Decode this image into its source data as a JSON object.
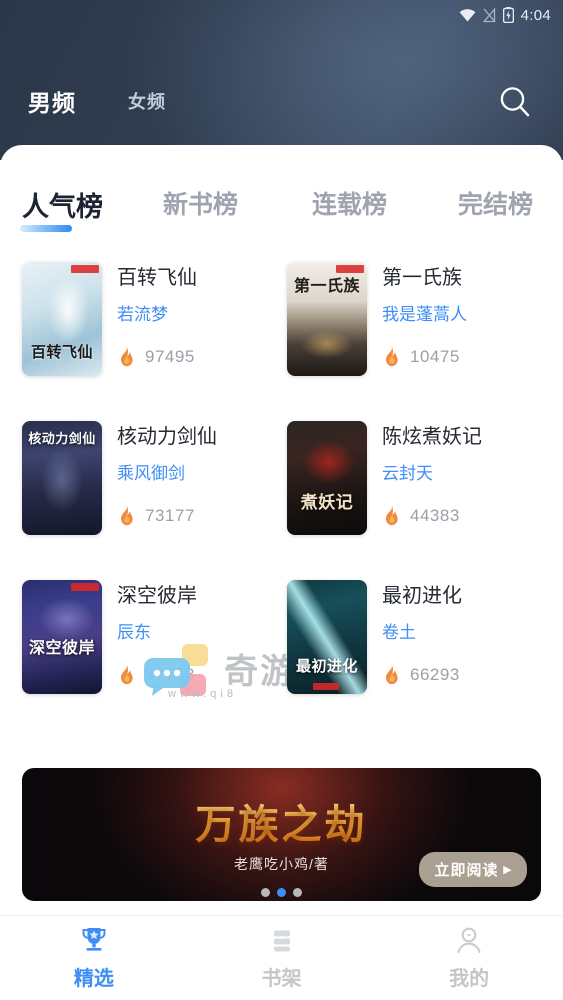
{
  "statusbar": {
    "time": "4:04",
    "icons": [
      "wifi-icon",
      "signal-off-icon",
      "battery-charging-icon"
    ]
  },
  "header": {
    "channels": [
      {
        "label": "男频",
        "active": true
      },
      {
        "label": "女频",
        "active": false
      }
    ],
    "search_icon": "search-icon",
    "bg_color": "#2b3748"
  },
  "rank_tabs": [
    {
      "label": "人气榜",
      "active": true
    },
    {
      "label": "新书榜",
      "active": false
    },
    {
      "label": "连载榜",
      "active": false
    },
    {
      "label": "完结榜",
      "active": false
    }
  ],
  "books": [
    {
      "title": "百转飞仙",
      "author": "若流梦",
      "hot": "97495",
      "cover_text": "百转飞仙"
    },
    {
      "title": "第一氏族",
      "author": "我是蓬蒿人",
      "hot": "10475",
      "cover_text": "第一氏族"
    },
    {
      "title": "核动力剑仙",
      "author": "乘风御剑",
      "hot": "73177",
      "cover_text": "核动力剑仙"
    },
    {
      "title": "陈炫煮妖记",
      "author": "云封天",
      "hot": "44383",
      "cover_text": "煮妖记"
    },
    {
      "title": "深空彼岸",
      "author": "辰东",
      "hot": "37758",
      "cover_text": "深空彼岸"
    },
    {
      "title": "最初进化",
      "author": "卷土",
      "hot": "66293",
      "cover_text": "最初进化"
    }
  ],
  "watermark": {
    "text": "奇游下",
    "url": "www.qi8"
  },
  "banner": {
    "title": "万族之劫",
    "author": "老鹰吃小鸡/著",
    "cta": "立即阅读",
    "cta_arrow": "▸",
    "dots": 3,
    "active_dot": 1
  },
  "bottom_nav": [
    {
      "label": "精选",
      "icon": "trophy-icon",
      "active": true
    },
    {
      "label": "书架",
      "icon": "bookshelf-icon",
      "active": false
    },
    {
      "label": "我的",
      "icon": "person-icon",
      "active": false
    }
  ],
  "colors": {
    "accent": "#3f8ef5",
    "header": "#2b3748",
    "hot": "#f08a3c",
    "muted": "#9ba0a8"
  }
}
